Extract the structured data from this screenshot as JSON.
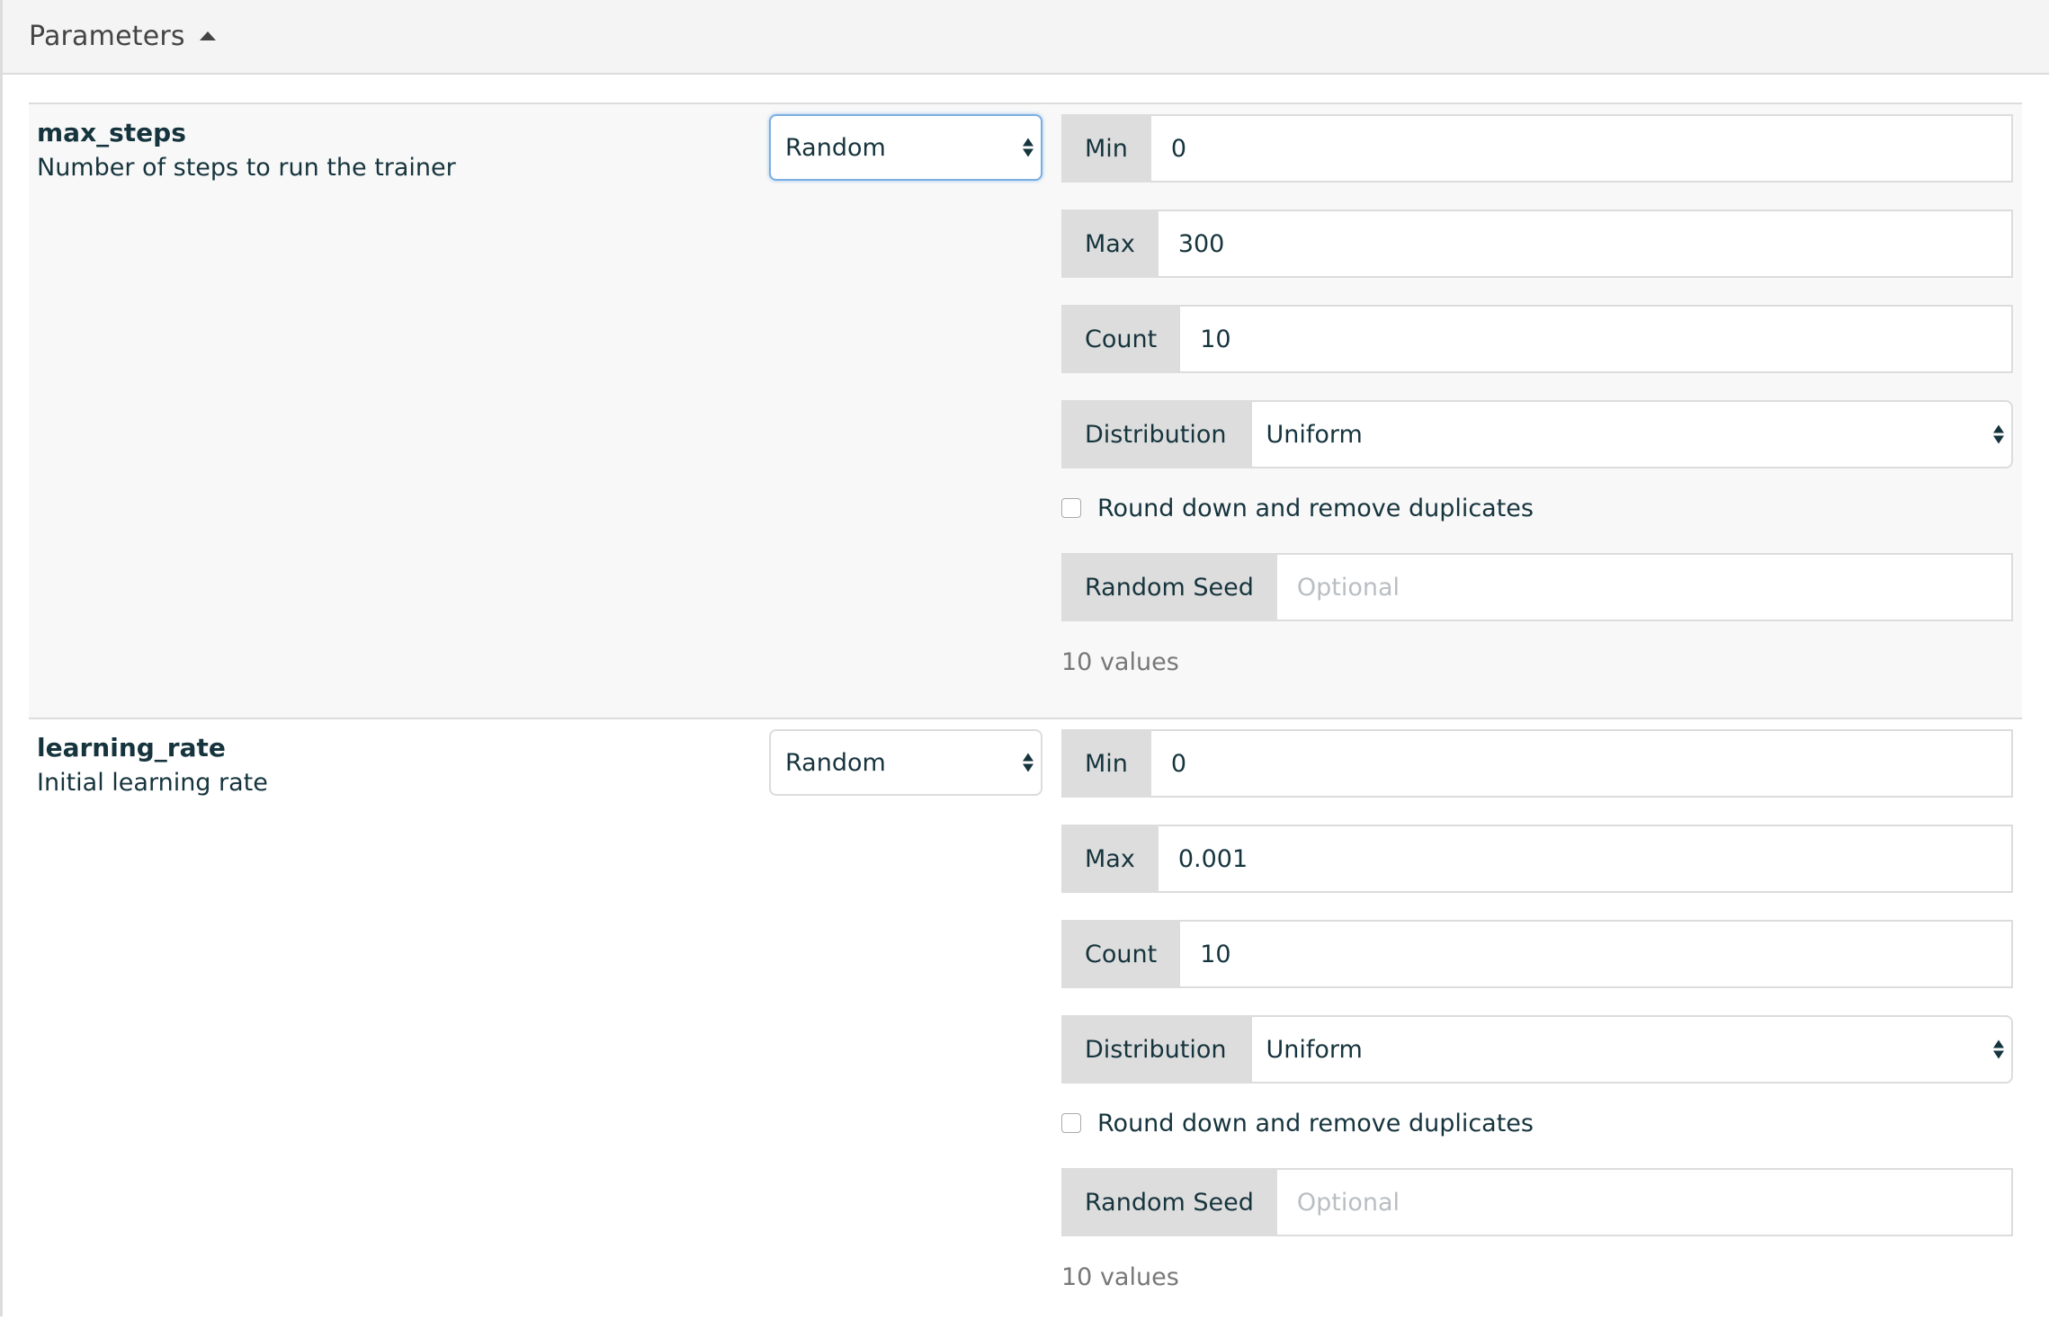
{
  "header": {
    "title": "Parameters",
    "toggle_icon": "caret-up-icon"
  },
  "parameters": [
    {
      "name": "max_steps",
      "description": "Number of steps to run the trainer",
      "mode": "Random",
      "mode_focused": true,
      "fields": {
        "min_label": "Min",
        "min_value": "0",
        "max_label": "Max",
        "max_value": "300",
        "count_label": "Count",
        "count_value": "10",
        "distribution_label": "Distribution",
        "distribution_value": "Uniform",
        "round_label": "Round down and remove duplicates",
        "round_checked": false,
        "seed_label": "Random Seed",
        "seed_placeholder": "Optional",
        "seed_value": ""
      },
      "summary": "10 values"
    },
    {
      "name": "learning_rate",
      "description": "Initial learning rate",
      "mode": "Random",
      "mode_focused": false,
      "fields": {
        "min_label": "Min",
        "min_value": "0",
        "max_label": "Max",
        "max_value": "0.001",
        "count_label": "Count",
        "count_value": "10",
        "distribution_label": "Distribution",
        "distribution_value": "Uniform",
        "round_label": "Round down and remove duplicates",
        "round_checked": false,
        "seed_label": "Random Seed",
        "seed_placeholder": "Optional",
        "seed_value": ""
      },
      "summary": "10 values"
    }
  ],
  "colors": {
    "text": "#16343d",
    "addon_bg": "#dddddd",
    "focus_ring": "#7aaee2",
    "header_bg": "#f4f4f4"
  }
}
